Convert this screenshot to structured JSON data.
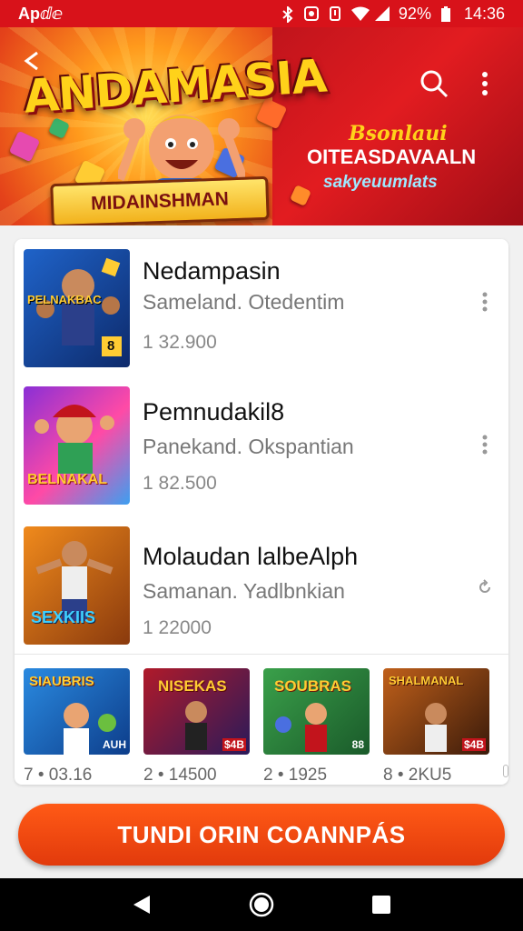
{
  "status_bar": {
    "app_label": "Apⅆⅇ",
    "battery": "92%",
    "time": "14:36"
  },
  "banner": {
    "title": "ANDAMASIA",
    "ribbon_text": "MIDAINSHMAN",
    "line1": "Bsonlaui",
    "line2": "OITEASDAVAALN",
    "line3": "sakyeuumlats"
  },
  "list": [
    {
      "title": "Nedampasin",
      "subtitle": "Sameland. Otedentim",
      "count": "1 32.900"
    },
    {
      "title": "Pemnudakil8",
      "subtitle": "Panekand. Okspantian",
      "count": "1 82.500"
    },
    {
      "title": "Molaudan lalbeAlph",
      "subtitle": "Samanan. Yadlbnkian",
      "count": "1 22000"
    }
  ],
  "list_thumbs": [
    {
      "caption": "PELNAKBAC",
      "badge": "8"
    },
    {
      "caption": "BELNAKAL",
      "badge": ""
    },
    {
      "caption": "SEXKIIS",
      "badge": ""
    }
  ],
  "grid": [
    {
      "caption": "SIAUBRIS",
      "count": "7 • 03.16",
      "tag": "AUH"
    },
    {
      "caption": "NISEKAS",
      "count": "2 • 14500",
      "tag": "$4B"
    },
    {
      "caption": "SOUBRAS",
      "count": "2 • 1925",
      "tag": "88"
    },
    {
      "caption": "SHALMANAL",
      "count": "8 • 2KU5",
      "tag": "$4B"
    }
  ],
  "cta_label": "TUNDI ORIN COANNPÁS",
  "colors": {
    "brand_red": "#d8121a",
    "cta_orange": "#f04a12"
  }
}
